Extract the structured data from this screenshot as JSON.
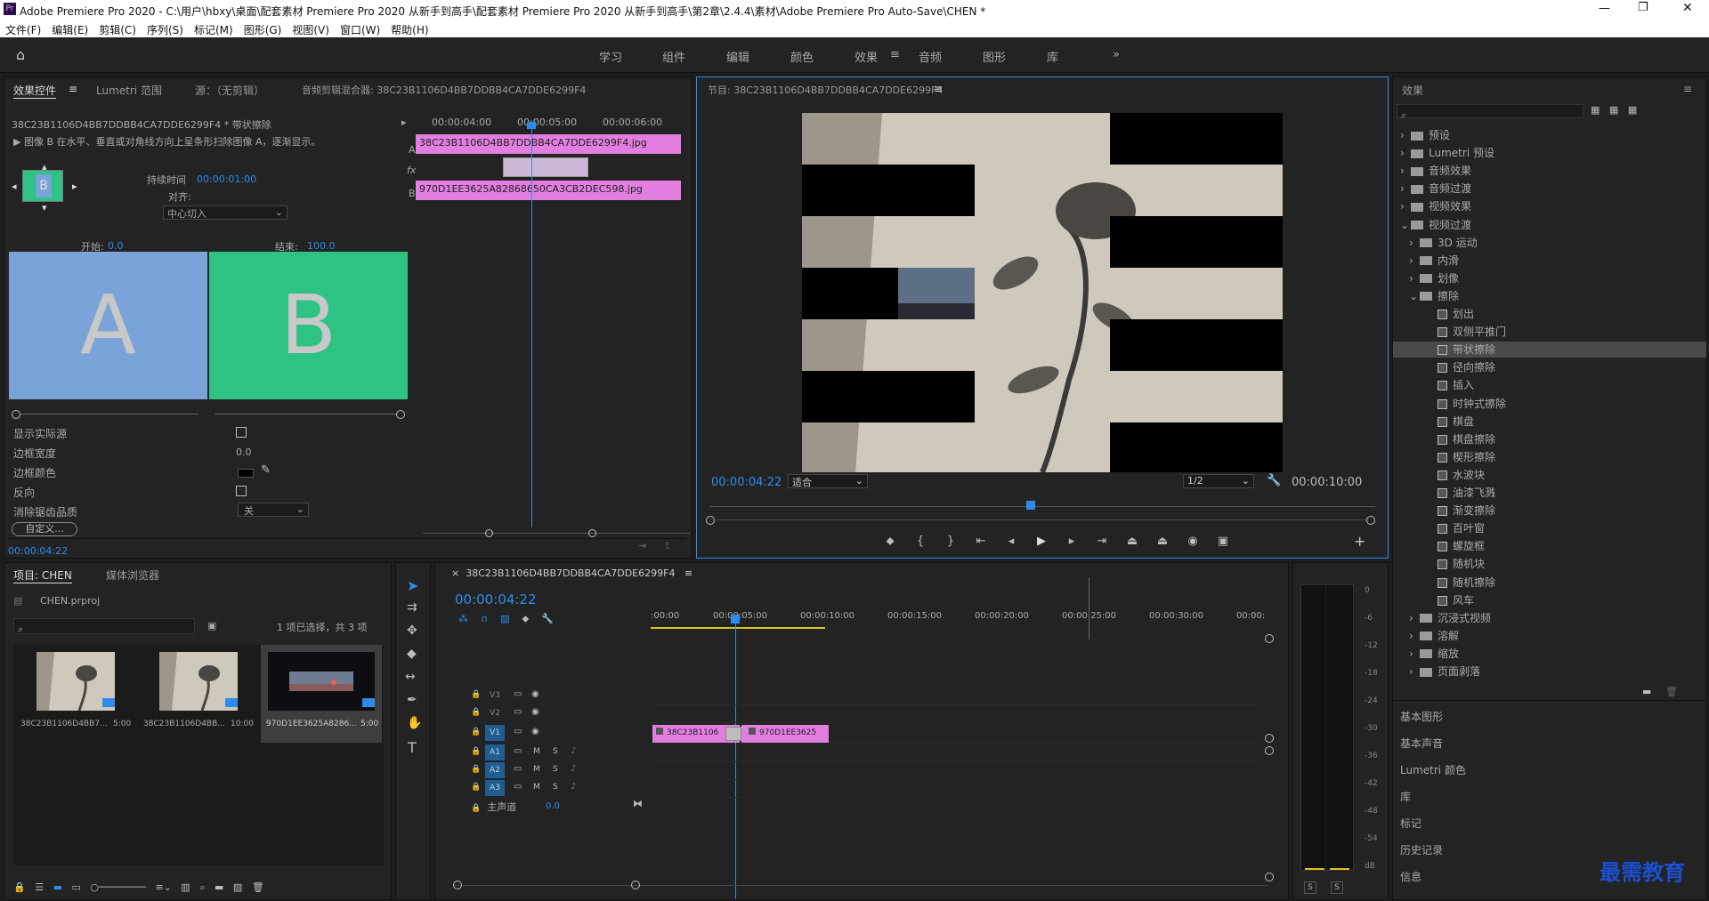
{
  "title_bar": {
    "app_title": "Adobe Premiere Pro 2020 - C:\\用户\\hbxy\\桌面\\配套素材 Premiere Pro 2020 从新手到高手\\配套素材 Premiere Pro 2020 从新手到高手\\第2章\\2.4.4\\素材\\Adobe Premiere Pro Auto-Save\\CHEN *"
  },
  "menu": [
    "文件(F)",
    "编辑(E)",
    "剪辑(C)",
    "序列(S)",
    "标记(M)",
    "图形(G)",
    "视图(V)",
    "窗口(W)",
    "帮助(H)"
  ],
  "workspaces": [
    "学习",
    "组件",
    "编辑",
    "颜色",
    "效果",
    "音频",
    "图形",
    "库"
  ],
  "active_workspace": "效果",
  "effect_controls": {
    "tabs": [
      "效果控件",
      "Lumetri 范围",
      "源：（无剪辑）",
      "音频剪辑混合器: 38C23B1106D4BB7DDBB4CA7DDE6299F4"
    ],
    "clip_title": "38C23B1106D4BB7DDBB4CA7DDE6299F4 * 带状擦除",
    "description": "图像 B 在水平、垂直或对角线方向上呈条形扫除图像 A，逐渐显示。",
    "duration_label": "持续时间",
    "duration_value": "00:00:01:00",
    "align_label": "对齐:",
    "align_value": "中心切入",
    "start_label": "开始:",
    "start_value": "0.0",
    "end_label": "结束:",
    "end_value": "100.0",
    "preview_a": "A",
    "preview_b": "B",
    "props": [
      {
        "label": "显示实际源",
        "type": "checkbox"
      },
      {
        "label": "边框宽度",
        "value": "0.0"
      },
      {
        "label": "边框颜色",
        "type": "color"
      },
      {
        "label": "反向",
        "type": "checkbox"
      },
      {
        "label": "消除锯齿品质",
        "value": "关"
      }
    ],
    "custom_button": "自定义...",
    "timecode": "00:00:04:22",
    "mini_timeline": {
      "t1": "00:00:04:00",
      "t2": "00:00:05:00",
      "t3": "00:00:06:00",
      "clip_a": "38C23B1106D4BB7DDBB4CA7DDE6299F4.jpg",
      "clip_b": "970D1EE3625A82868650CA3CB2DEC598.jpg",
      "label_a": "A",
      "label_b": "B",
      "fx": "fx"
    }
  },
  "program": {
    "title": "节目: 38C23B1106D4BB7DDBB4CA7DDE6299F4",
    "timecode": "00:00:04:22",
    "fit": "适合",
    "quality": "1/2",
    "duration": "00:00:10:00"
  },
  "effects": {
    "title": "效果",
    "tree": [
      {
        "label": "预设",
        "level": 0,
        "kind": "folder",
        "exp": "›"
      },
      {
        "label": "Lumetri 预设",
        "level": 0,
        "kind": "folder",
        "exp": "›"
      },
      {
        "label": "音频效果",
        "level": 0,
        "kind": "folder",
        "exp": "›"
      },
      {
        "label": "音频过渡",
        "level": 0,
        "kind": "folder",
        "exp": "›"
      },
      {
        "label": "视频效果",
        "level": 0,
        "kind": "folder",
        "exp": "›"
      },
      {
        "label": "视频过渡",
        "level": 0,
        "kind": "folder",
        "exp": "⌄"
      },
      {
        "label": "3D 运动",
        "level": 1,
        "kind": "folder",
        "exp": "›"
      },
      {
        "label": "内滑",
        "level": 1,
        "kind": "folder",
        "exp": "›"
      },
      {
        "label": "划像",
        "level": 1,
        "kind": "folder",
        "exp": "›"
      },
      {
        "label": "擦除",
        "level": 1,
        "kind": "folder",
        "exp": "⌄"
      },
      {
        "label": "划出",
        "level": 2,
        "kind": "fx"
      },
      {
        "label": "双侧平推门",
        "level": 2,
        "kind": "fx"
      },
      {
        "label": "带状擦除",
        "level": 2,
        "kind": "fx",
        "selected": true
      },
      {
        "label": "径向擦除",
        "level": 2,
        "kind": "fx"
      },
      {
        "label": "插入",
        "level": 2,
        "kind": "fx"
      },
      {
        "label": "时钟式擦除",
        "level": 2,
        "kind": "fx"
      },
      {
        "label": "棋盘",
        "level": 2,
        "kind": "fx"
      },
      {
        "label": "棋盘擦除",
        "level": 2,
        "kind": "fx"
      },
      {
        "label": "楔形擦除",
        "level": 2,
        "kind": "fx"
      },
      {
        "label": "水波块",
        "level": 2,
        "kind": "fx"
      },
      {
        "label": "油漆飞溅",
        "level": 2,
        "kind": "fx"
      },
      {
        "label": "渐变擦除",
        "level": 2,
        "kind": "fx"
      },
      {
        "label": "百叶窗",
        "level": 2,
        "kind": "fx"
      },
      {
        "label": "螺旋框",
        "level": 2,
        "kind": "fx"
      },
      {
        "label": "随机块",
        "level": 2,
        "kind": "fx"
      },
      {
        "label": "随机擦除",
        "level": 2,
        "kind": "fx"
      },
      {
        "label": "风车",
        "level": 2,
        "kind": "fx"
      },
      {
        "label": "沉浸式视频",
        "level": 1,
        "kind": "folder",
        "exp": "›"
      },
      {
        "label": "溶解",
        "level": 1,
        "kind": "folder",
        "exp": "›"
      },
      {
        "label": "缩放",
        "level": 1,
        "kind": "folder",
        "exp": "›"
      },
      {
        "label": "页面剥落",
        "level": 1,
        "kind": "folder",
        "exp": "›"
      }
    ],
    "panels": [
      "基本图形",
      "基本声音",
      "Lumetri 颜色",
      "库",
      "标记",
      "历史记录",
      "信息"
    ]
  },
  "project": {
    "tabs": [
      "项目: CHEN",
      "媒体浏览器"
    ],
    "file": "CHEN.prproj",
    "selection": "1 项已选择，共 3 项",
    "items": [
      {
        "name": "38C23B1106D4BB7...",
        "dur": "5:00"
      },
      {
        "name": "38C23B1106D4BB...",
        "dur": "10:00"
      },
      {
        "name": "970D1EE3625A8286...",
        "dur": "5:00"
      }
    ]
  },
  "timeline": {
    "tab": "38C23B1106D4BB7DDBB4CA7DDE6299F4",
    "timecode": "00:00:04:22",
    "ruler": [
      ":00:00",
      "00:00:05:00",
      "00:00:10:00",
      "00:00:15:00",
      "00:00:20:00",
      "00:00:25:00",
      "00:00:30:00",
      "00:00:"
    ],
    "video_tracks": [
      "V3",
      "V2",
      "V1"
    ],
    "audio_tracks": [
      "A1",
      "A2",
      "A3"
    ],
    "master": "主声道",
    "master_value": "0.0",
    "clip1": "38C23B1106",
    "clip2": "970D1EE3625"
  },
  "meter": {
    "labels": [
      "0",
      "-6",
      "-12",
      "-18",
      "-24",
      "-30",
      "-36",
      "-42",
      "-48",
      "-54",
      "dB"
    ],
    "solo": [
      "S",
      "S"
    ]
  },
  "watermark": "最需教育",
  "colors": {
    "accent": "#2d8ceb",
    "clip": "#e27ee0",
    "a_tile": "#7aa3d9",
    "b_tile": "#2ec285"
  }
}
